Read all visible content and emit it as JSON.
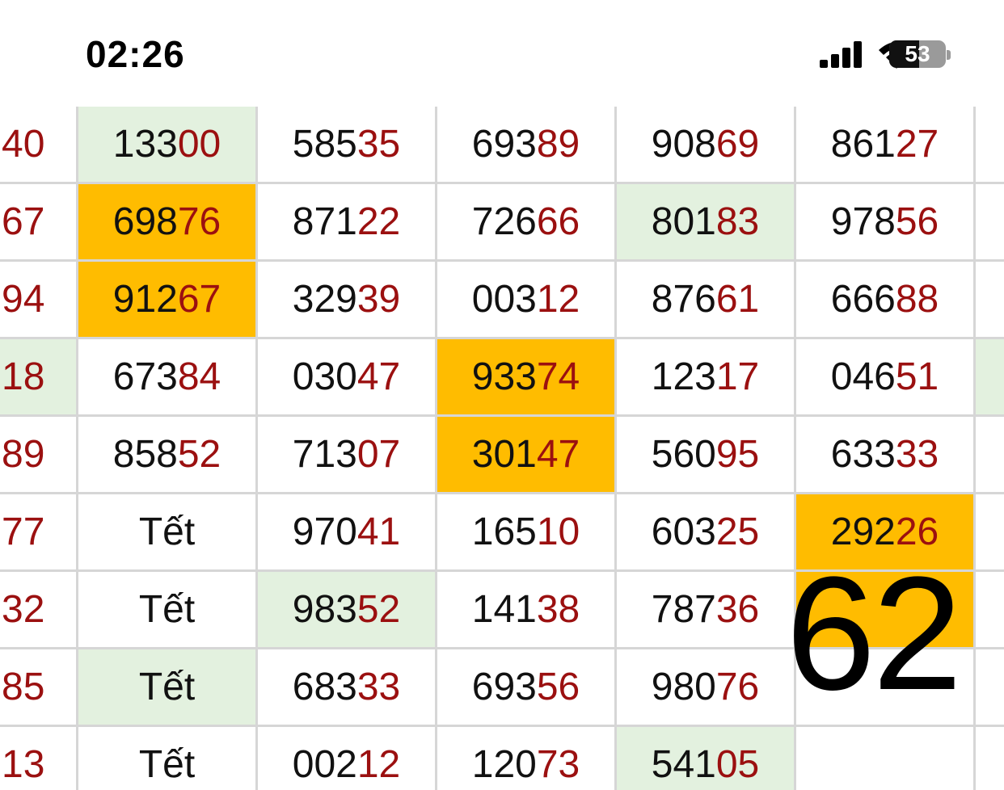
{
  "status_bar": {
    "time": "02:26",
    "battery_level": "53",
    "icons": [
      "signal-icon",
      "wifi-icon",
      "battery-icon"
    ]
  },
  "colors": {
    "highlight_green": "#e3f1df",
    "highlight_orange": "#ffbc00",
    "tail_digits": "#9b1010",
    "grid_line": "#d6d6d6"
  },
  "rows": [
    {
      "first": "40",
      "cells": [
        {
          "head": "133",
          "tail": "00",
          "hl": "green"
        },
        {
          "head": "585",
          "tail": "35",
          "hl": ""
        },
        {
          "head": "693",
          "tail": "89",
          "hl": ""
        },
        {
          "head": "908",
          "tail": "69",
          "hl": ""
        },
        {
          "head": "861",
          "tail": "27",
          "hl": ""
        }
      ],
      "last_hl": ""
    },
    {
      "first": "67",
      "cells": [
        {
          "head": "698",
          "tail": "76",
          "hl": "orange"
        },
        {
          "head": "871",
          "tail": "22",
          "hl": ""
        },
        {
          "head": "726",
          "tail": "66",
          "hl": ""
        },
        {
          "head": "801",
          "tail": "83",
          "hl": "green"
        },
        {
          "head": "978",
          "tail": "56",
          "hl": ""
        }
      ],
      "last_hl": ""
    },
    {
      "first": "94",
      "cells": [
        {
          "head": "912",
          "tail": "67",
          "hl": "orange"
        },
        {
          "head": "329",
          "tail": "39",
          "hl": ""
        },
        {
          "head": "003",
          "tail": "12",
          "hl": ""
        },
        {
          "head": "876",
          "tail": "61",
          "hl": ""
        },
        {
          "head": "666",
          "tail": "88",
          "hl": ""
        }
      ],
      "last_hl": ""
    },
    {
      "first": "18",
      "first_hl": "green",
      "cells": [
        {
          "head": "673",
          "tail": "84",
          "hl": ""
        },
        {
          "head": "030",
          "tail": "47",
          "hl": ""
        },
        {
          "head": "933",
          "tail": "74",
          "hl": "orange"
        },
        {
          "head": "123",
          "tail": "17",
          "hl": ""
        },
        {
          "head": "046",
          "tail": "51",
          "hl": ""
        }
      ],
      "last_hl": "green"
    },
    {
      "first": "89",
      "cells": [
        {
          "head": "858",
          "tail": "52",
          "hl": ""
        },
        {
          "head": "713",
          "tail": "07",
          "hl": ""
        },
        {
          "head": "301",
          "tail": "47",
          "hl": "orange"
        },
        {
          "head": "560",
          "tail": "95",
          "hl": ""
        },
        {
          "head": "633",
          "tail": "33",
          "hl": ""
        }
      ],
      "last_hl": ""
    },
    {
      "first": "77",
      "cells": [
        {
          "head": "Tết",
          "tail": "",
          "hl": ""
        },
        {
          "head": "970",
          "tail": "41",
          "hl": ""
        },
        {
          "head": "165",
          "tail": "10",
          "hl": ""
        },
        {
          "head": "603",
          "tail": "25",
          "hl": ""
        },
        {
          "head": "292",
          "tail": "26",
          "hl": "orange"
        }
      ],
      "last_hl": ""
    },
    {
      "first": "32",
      "cells": [
        {
          "head": "Tết",
          "tail": "",
          "hl": ""
        },
        {
          "head": "983",
          "tail": "52",
          "hl": "green"
        },
        {
          "head": "141",
          "tail": "38",
          "hl": ""
        },
        {
          "head": "787",
          "tail": "36",
          "hl": ""
        },
        {
          "head": "",
          "tail": "",
          "hl": "orange"
        }
      ],
      "last_hl": ""
    },
    {
      "first": "85",
      "cells": [
        {
          "head": "Tết",
          "tail": "",
          "hl": "green"
        },
        {
          "head": "683",
          "tail": "33",
          "hl": ""
        },
        {
          "head": "693",
          "tail": "56",
          "hl": ""
        },
        {
          "head": "980",
          "tail": "76",
          "hl": ""
        },
        {
          "head": "",
          "tail": "",
          "hl": ""
        }
      ],
      "last_hl": ""
    },
    {
      "first": "13",
      "cells": [
        {
          "head": "Tết",
          "tail": "",
          "hl": ""
        },
        {
          "head": "002",
          "tail": "12",
          "hl": ""
        },
        {
          "head": "120",
          "tail": "73",
          "hl": ""
        },
        {
          "head": "541",
          "tail": "05",
          "hl": "green"
        },
        {
          "head": "",
          "tail": "",
          "hl": ""
        }
      ],
      "last_hl": ""
    }
  ],
  "overlay_number": "62"
}
